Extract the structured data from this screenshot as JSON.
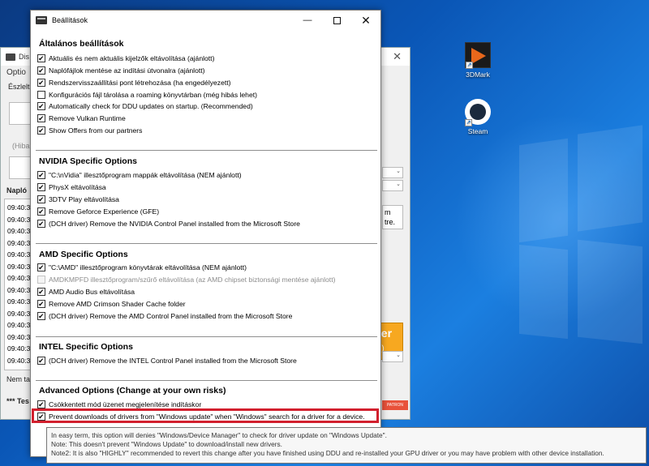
{
  "desktop": {
    "icons": [
      {
        "label": "3DMark",
        "icon": "3dmark-icon"
      },
      {
        "label": "Steam",
        "icon": "steam-icon"
      }
    ]
  },
  "background_window": {
    "title": "Dis",
    "menu": "Optio",
    "label_top": "Észlelt",
    "label_hint": "(Hiba",
    "log_header": "Napló",
    "log_times": [
      "09:40:3",
      "09:40:3",
      "09:40:3",
      "09:40:3",
      "09:40:3",
      "09:40:3",
      "09:40:3",
      "09:40:3",
      "09:40:3",
      "09:40:3",
      "09:40:3",
      "09:40:3",
      "09:40:3",
      "09:40:3"
    ],
    "right_text_1": "m",
    "right_text_2": "tre.",
    "orange_text_1": "ver",
    "orange_text_2": "rs)",
    "footer_1": "Nem ta",
    "footer_2": "*** Tes",
    "patron": "PATRON"
  },
  "settings": {
    "title": "Beállítások",
    "sections": [
      {
        "title": "Általános beállítások",
        "options": [
          {
            "label": "Aktuális és nem aktuális kijelzők eltávolítása (ajánlott)",
            "checked": true
          },
          {
            "label": "Naplófájlok mentése az indítási útvonalra (ajánlott)",
            "checked": true
          },
          {
            "label": "Rendszervisszaállítási pont létrehozása (ha engedélyezett)",
            "checked": true
          },
          {
            "label": "Konfigurációs fájl tárolása a roaming könyvtárban (még hibás lehet)",
            "checked": false
          },
          {
            "label": "Automatically check for DDU updates on startup. (Recommended)",
            "checked": true
          },
          {
            "label": "Remove Vulkan Runtime",
            "checked": true
          },
          {
            "label": "Show Offers from our partners",
            "checked": true
          }
        ]
      },
      {
        "title": "NVIDIA Specific Options",
        "options": [
          {
            "label": "\"C:\\nVidia\" illesztőprogram mappák eltávolítása (NEM ajánlott)",
            "checked": true
          },
          {
            "label": "PhysX eltávolítása",
            "checked": true
          },
          {
            "label": "3DTV Play eltávolítása",
            "checked": true
          },
          {
            "label": "Remove Geforce Experience (GFE)",
            "checked": true
          },
          {
            "label": "(DCH driver) Remove the NVIDIA Control Panel installed from the Microsoft Store",
            "checked": true
          }
        ]
      },
      {
        "title": "AMD Specific Options",
        "options": [
          {
            "label": "\"C:\\AMD\" illesztőprogram könyvtárak eltávolítása (NEM ajánlott)",
            "checked": true
          },
          {
            "label": "AMDKMPFD illesztőprogram/szűrő eltávolítása (az AMD chipset biztonsági mentése ajánlott)",
            "checked": false,
            "disabled": true
          },
          {
            "label": "AMD Audio Bus eltávolítása",
            "checked": true
          },
          {
            "label": "Remove AMD Crimson Shader Cache folder",
            "checked": true
          },
          {
            "label": "(DCH driver) Remove the AMD Control Panel installed from the Microsoft Store",
            "checked": true
          }
        ]
      },
      {
        "title": "INTEL Specific Options",
        "options": [
          {
            "label": "(DCH driver) Remove the INTEL Control Panel installed from the Microsoft Store",
            "checked": true
          }
        ]
      },
      {
        "title": "Advanced Options (Change at your own risks)",
        "options": [
          {
            "label": "Csökkentett mód üzenet megjelenítése indításkor",
            "checked": true
          },
          {
            "label": "Prevent downloads of drivers from \"Windows update\" when \"Windows\" search for a driver for a device.",
            "checked": true
          }
        ]
      }
    ]
  },
  "tooltip": {
    "lines": [
      "In easy term, this option will denies \"Windows/Device Manager\" to check for driver update on \"Windows Update\".",
      "Note: This doesn't prevent \"Windows Update\" to download/install new drivers.",
      "Note2: It is also \"HIGHLY\" recommended to revert this change after you have finished using DDU and re-installed your GPU driver or you may have problem with other device installation."
    ]
  },
  "colors": {
    "highlight": "#d2202e",
    "desktop_blue": "#0a56b6",
    "orange_button": "#f7a820"
  }
}
